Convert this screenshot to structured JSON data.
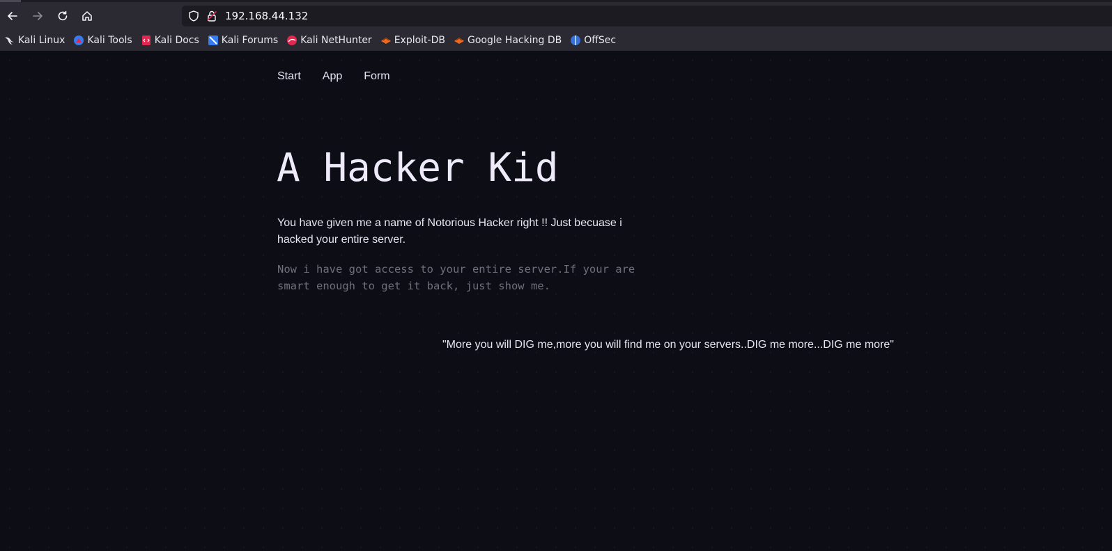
{
  "browser": {
    "url": "192.168.44.132",
    "bookmarks": [
      {
        "label": "Kali Linux",
        "icon": "kali-dragon-icon"
      },
      {
        "label": "Kali Tools",
        "icon": "kali-tools-icon"
      },
      {
        "label": "Kali Docs",
        "icon": "kali-docs-icon"
      },
      {
        "label": "Kali Forums",
        "icon": "kali-forums-icon"
      },
      {
        "label": "Kali NetHunter",
        "icon": "kali-nethunter-icon"
      },
      {
        "label": "Exploit-DB",
        "icon": "exploit-db-icon"
      },
      {
        "label": "Google Hacking DB",
        "icon": "ghdb-icon"
      },
      {
        "label": "OffSec",
        "icon": "offsec-icon"
      }
    ]
  },
  "site": {
    "nav": [
      "Start",
      "App",
      "Form"
    ],
    "title": "A Hacker Kid",
    "intro": "You have given me a name of Notorious Hacker right !! Just becuase i hacked your entire server.",
    "mono_note": "Now i have got access to your entire server.If your are smart enough to get it back, just show me.",
    "quote": "\"More you will DIG me,more you will find me on your servers..DIG me more...DIG me more\""
  },
  "colors": {
    "page_bg": "#0d0e15",
    "chrome_bg": "#2b2a33",
    "urlbar_bg": "#1c1b22",
    "title_color": "#eeeafa",
    "muted_mono": "#6f6f7c"
  }
}
